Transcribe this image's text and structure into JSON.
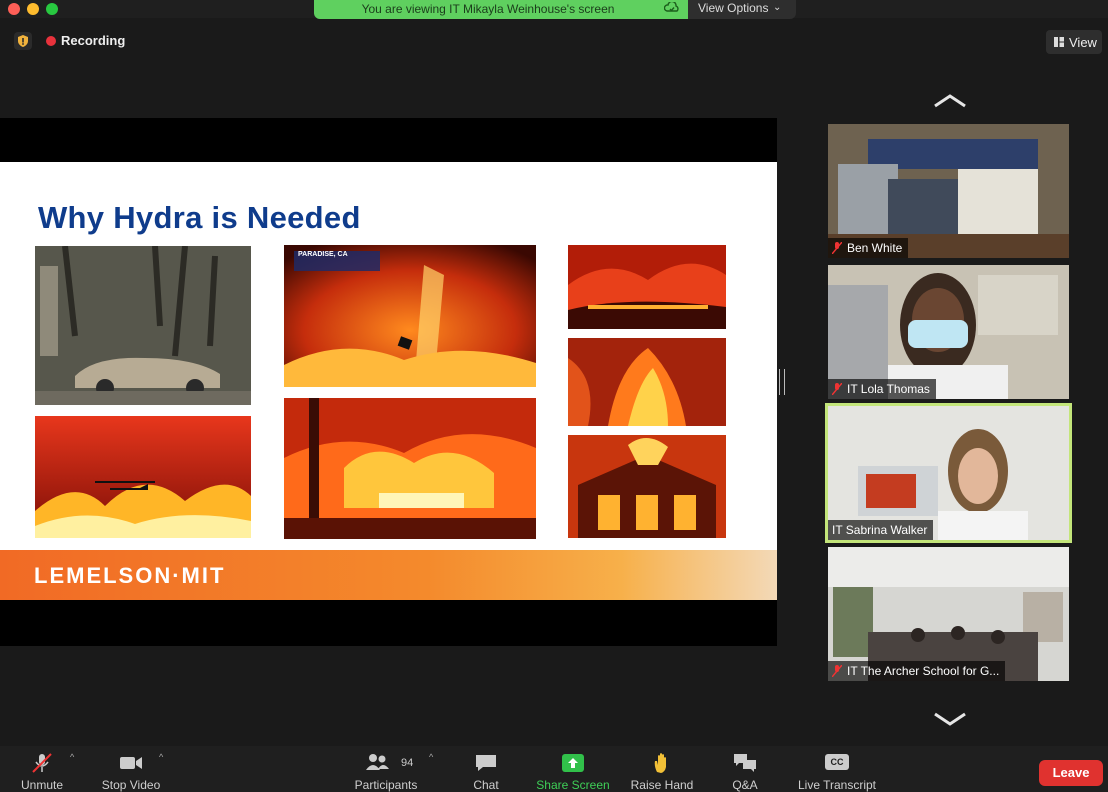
{
  "banner": {
    "text": "You are viewing IT Mikayla Weinhouse's screen",
    "view_options": "View Options"
  },
  "recording": {
    "label": "Recording"
  },
  "view_button": {
    "label": "View"
  },
  "slide": {
    "title": "Why Hydra is Needed",
    "footer_logo": "LEMELSON·MIT",
    "news_caption": "PARADISE, CA"
  },
  "participants_tiles": [
    {
      "name": "Ben White",
      "muted": true
    },
    {
      "name": "IT Lola Thomas",
      "muted": true
    },
    {
      "name": "IT Sabrina Walker",
      "muted": false,
      "active": true
    },
    {
      "name": "IT The Archer School for G...",
      "muted": true
    }
  ],
  "toolbar": {
    "unmute": "Unmute",
    "stop_video": "Stop Video",
    "participants": "Participants",
    "participants_count": "94",
    "chat": "Chat",
    "share_screen": "Share Screen",
    "raise_hand": "Raise Hand",
    "qa": "Q&A",
    "live_transcript": "Live Transcript",
    "cc": "CC",
    "leave": "Leave"
  },
  "colors": {
    "share_green": "#5fd05f",
    "leave_red": "#e0322f",
    "active_tile": "#c3e57a",
    "slide_title": "#0f3c8c"
  }
}
